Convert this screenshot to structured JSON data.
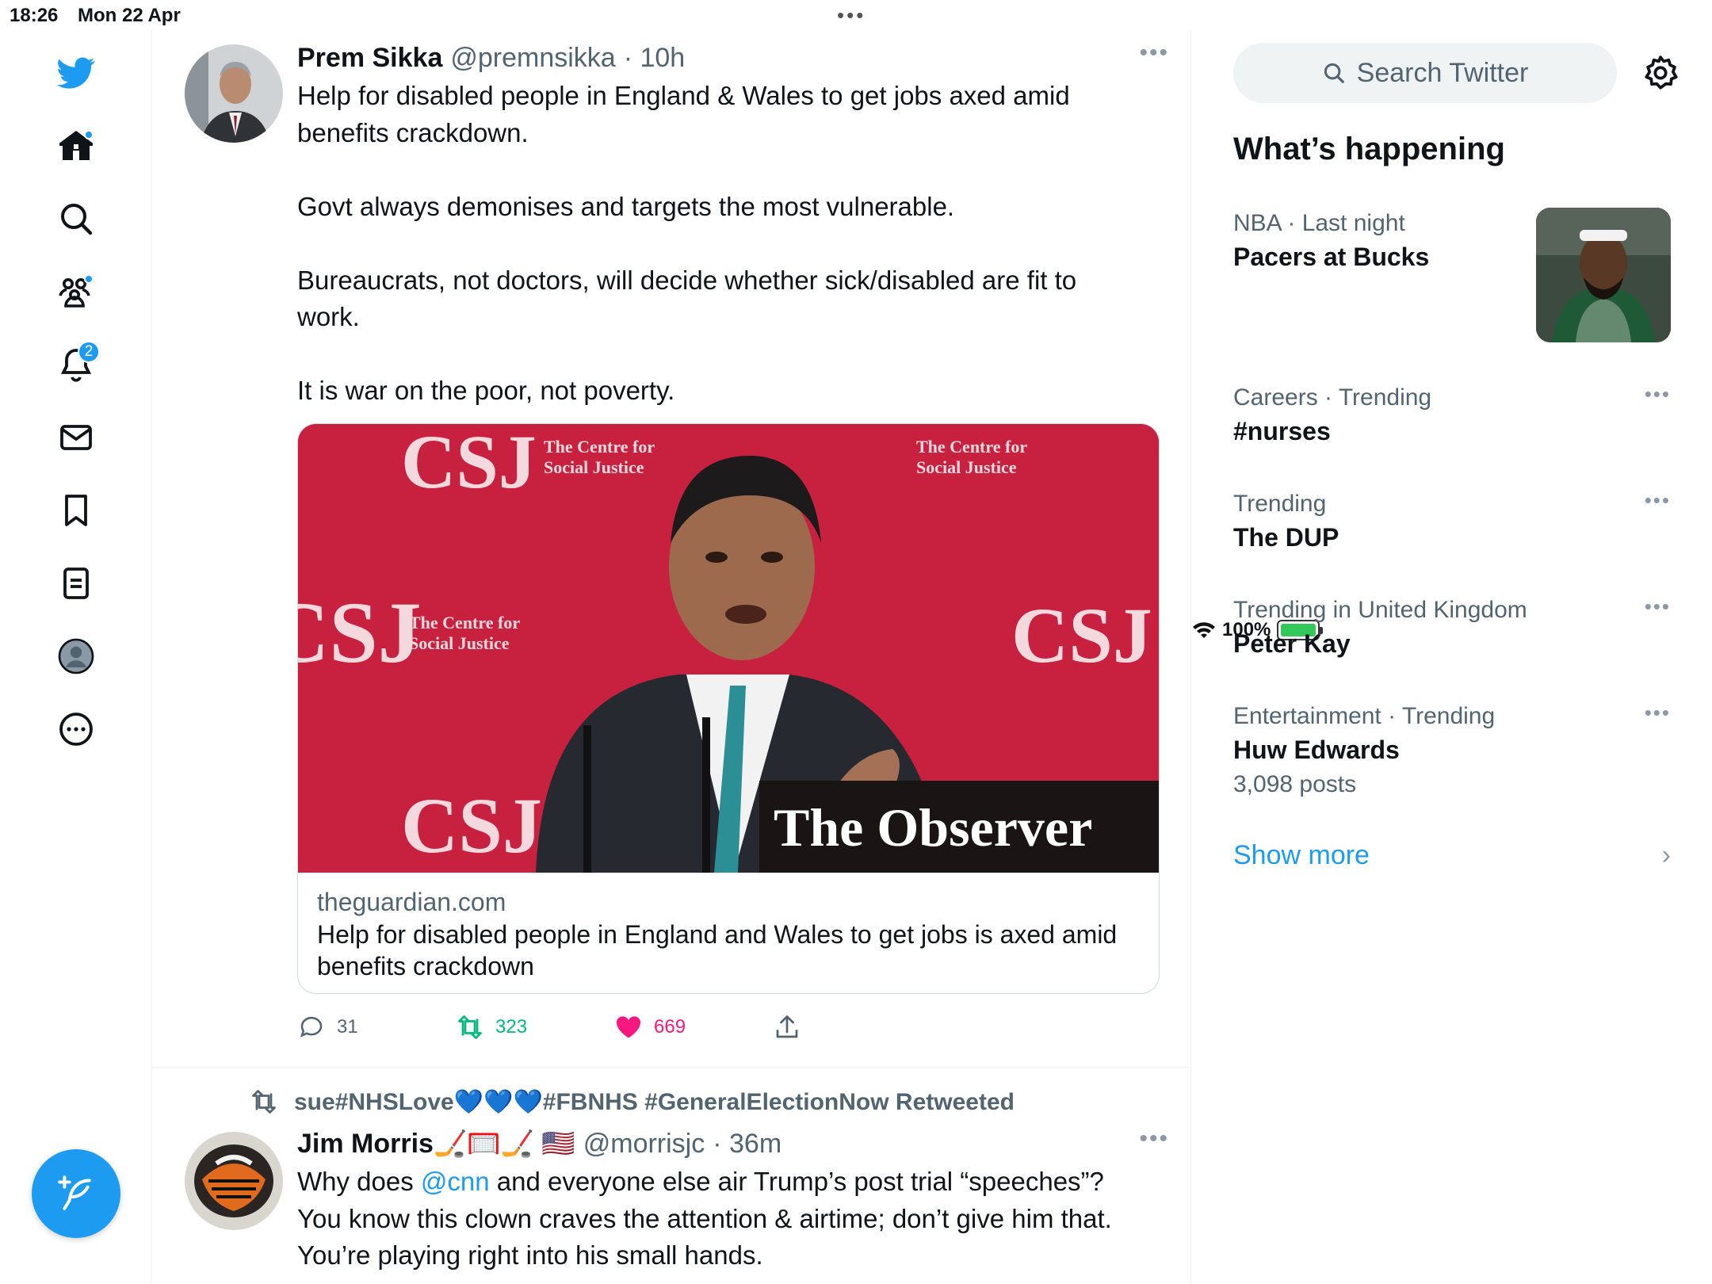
{
  "status_bar": {
    "time": "18:26",
    "date": "Mon 22 Apr",
    "battery": "100%"
  },
  "sidebar": {
    "notification_count": "2"
  },
  "tweets": [
    {
      "name": "Prem Sikka",
      "handle": "@premnsikka",
      "time": "· 10h",
      "text": "Help for disabled people in England & Wales to get jobs axed amid\nbenefits crackdown.\n\nGovt always demonises and targets the most vulnerable.\n\nBureaucrats, not doctors, will decide whether sick/disabled are fit to\nwork.\n\nIt is war on the poor, not poverty.",
      "card": {
        "image_wordmark": "The Observer",
        "image_logo": "CSJ",
        "image_logo_sub_1": "The Centre for",
        "image_logo_sub_2": "Social Justice",
        "domain": "theguardian.com",
        "title": "Help for disabled people in England and Wales to get jobs is axed amid benefits crackdown"
      },
      "replies": "31",
      "retweets": "323",
      "likes": "669"
    },
    {
      "retweeted_by": "sue#NHSLove💙💙💙#FBNHS #GeneralElectionNow Retweeted",
      "name": "Jim Morris🏒🥅🏒 🇺🇸",
      "handle": "@morrisjc",
      "time": "· 36m",
      "text_before": "Why does ",
      "mention": "@cnn",
      "text_after": " and everyone else air Trump’s post trial “speeches”?\nYou know this clown craves the attention & airtime; don’t give him that.\nYou’re playing right into his small hands."
    }
  ],
  "right": {
    "search_placeholder": "Search Twitter",
    "section_title": "What’s happening",
    "trends": [
      {
        "meta": "NBA · Last night",
        "name": "Pacers at Bucks",
        "count": ""
      },
      {
        "meta": "Careers · Trending",
        "name": "#nurses",
        "count": ""
      },
      {
        "meta": "Trending",
        "name": "The DUP",
        "count": ""
      },
      {
        "meta": "Trending in United Kingdom",
        "name": "Peter Kay",
        "count": ""
      },
      {
        "meta": "Entertainment · Trending",
        "name": "Huw Edwards",
        "count": "3,098 posts"
      }
    ],
    "show_more": "Show more"
  },
  "colors": {
    "accent": "#1d9bf0",
    "like": "#f91880",
    "retweet": "#00ba7c"
  }
}
